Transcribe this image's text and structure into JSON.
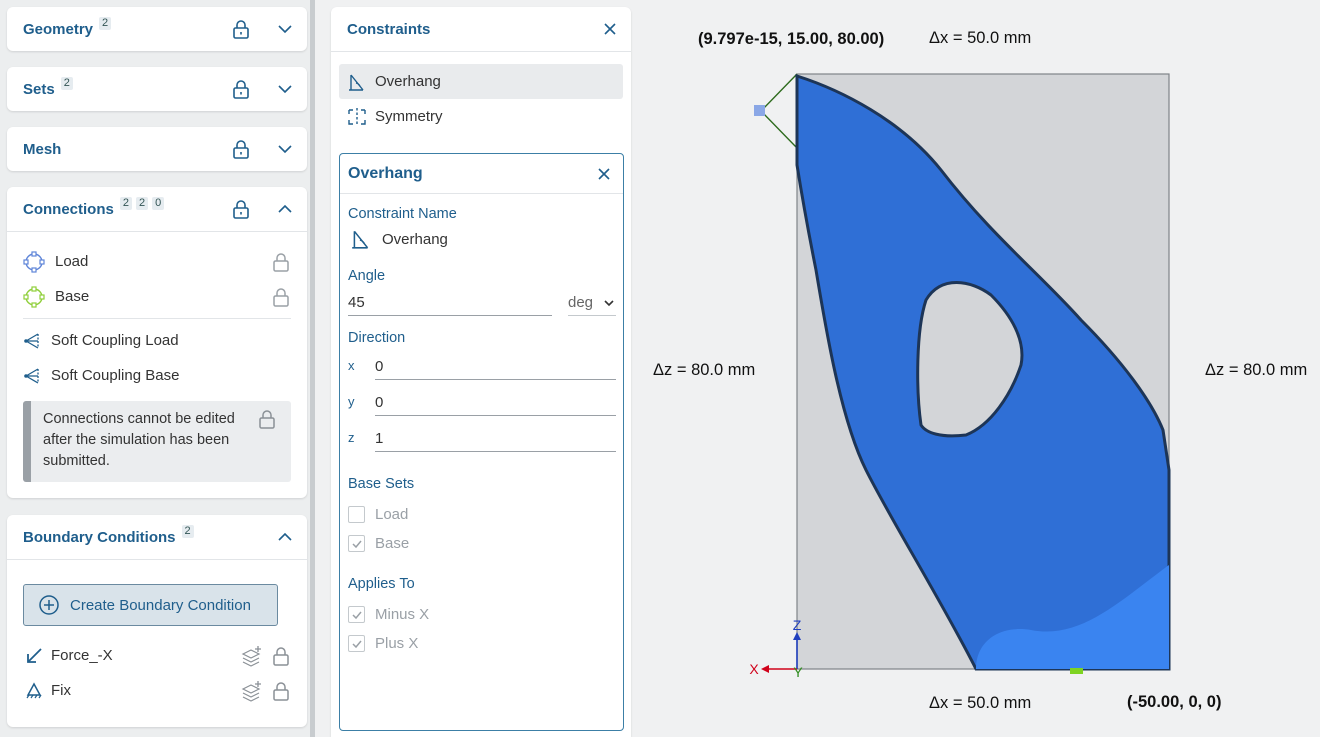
{
  "left_panel": {
    "geometry": {
      "title": "Geometry",
      "badge": "2"
    },
    "sets": {
      "title": "Sets",
      "badge": "2"
    },
    "mesh": {
      "title": "Mesh"
    },
    "connections": {
      "title": "Connections",
      "badges": [
        "2",
        "2",
        "0"
      ],
      "items": [
        {
          "label": "Load",
          "icon": "load-set-icon"
        },
        {
          "label": "Base",
          "icon": "base-set-icon"
        },
        {
          "label": "Soft Coupling Load",
          "icon": "soft-coupling-icon"
        },
        {
          "label": "Soft Coupling Base",
          "icon": "soft-coupling-icon"
        }
      ],
      "note": "Connections cannot be edited after the simulation has been submitted."
    },
    "boundary_conditions": {
      "title": "Boundary Conditions",
      "badge": "2",
      "create_label": "Create Boundary Condition",
      "items": [
        {
          "label": "Force_-X",
          "icon": "force-arrow-icon"
        },
        {
          "label": "Fix",
          "icon": "fix-support-icon"
        }
      ]
    }
  },
  "constraints_panel": {
    "title": "Constraints",
    "items": [
      {
        "label": "Overhang",
        "selected": true
      },
      {
        "label": "Symmetry",
        "selected": false
      }
    ],
    "detail": {
      "title": "Overhang",
      "name_label": "Constraint Name",
      "name_value": "Overhang",
      "angle_label": "Angle",
      "angle_value": "45",
      "angle_unit": "deg",
      "direction_label": "Direction",
      "direction": {
        "x": "0",
        "y": "0",
        "z": "1"
      },
      "base_sets_label": "Base Sets",
      "base_sets": [
        {
          "label": "Load",
          "checked": false
        },
        {
          "label": "Base",
          "checked": true
        }
      ],
      "applies_to_label": "Applies To",
      "applies_to": [
        {
          "label": "Minus X",
          "checked": true
        },
        {
          "label": "Plus X",
          "checked": true
        }
      ]
    }
  },
  "viewport": {
    "coord_top": "(9.797e-15, 15.00, 80.00)",
    "dx_top": "Δx = 50.0 mm",
    "dz_left": "Δz = 80.0 mm",
    "dz_right": "Δz = 80.0 mm",
    "dx_bottom": "Δx = 50.0 mm",
    "coord_bottom": "(-50.00, 0, 0)",
    "axis_z": "Z",
    "axis_x": "X",
    "axis_y": "Y",
    "colors": {
      "part": "#2f6fd6",
      "bbox": "#d3d5d8",
      "accent": "#1f5e8c"
    }
  }
}
